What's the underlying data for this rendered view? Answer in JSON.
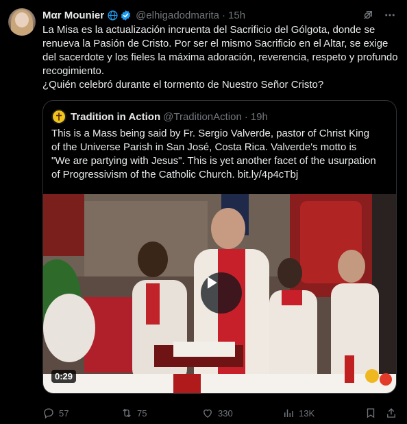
{
  "tweet": {
    "author_name": "Mαr Mounier",
    "handle": "@elhigadodmarita",
    "separator": "·",
    "time": "15h",
    "text": "La Misa es la actualización incruenta del Sacrificio del Gólgota, donde se renueva la Pasión de Cristo.  Por ser el mismo Sacrificio en el Altar, se exige del sacerdote y los fieles la máxima adoración, reverencia, respeto y profundo recogimiento.\n¿Quién celebró durante el tormento de Nuestro Señor Cristo?",
    "icons": {
      "globe": "globe-icon",
      "verified": "verified-badge-icon",
      "grok": "grok-icon",
      "more": "more-icon"
    }
  },
  "quote": {
    "author_name": "Tradition in Action",
    "handle": "@TraditionAction",
    "separator": "·",
    "time": "19h",
    "text": "This is a Mass being said by Fr. Sergio Valverde, pastor of Christ King of the Universe Parish in San José, Costa Rica. Valverde's motto is \"We are partying with Jesus\". This is yet another facet of the usurpation of Progressivism of the Catholic Church. bit.ly/4p4cTbj",
    "video": {
      "duration": "0:29"
    }
  },
  "actions": {
    "replies": "57",
    "retweets": "75",
    "likes": "330",
    "views": "13K"
  },
  "colors": {
    "background": "#000000",
    "text": "#e7e9ea",
    "muted": "#71767b",
    "border": "#2f3336",
    "verified": "#1d9bf0"
  }
}
